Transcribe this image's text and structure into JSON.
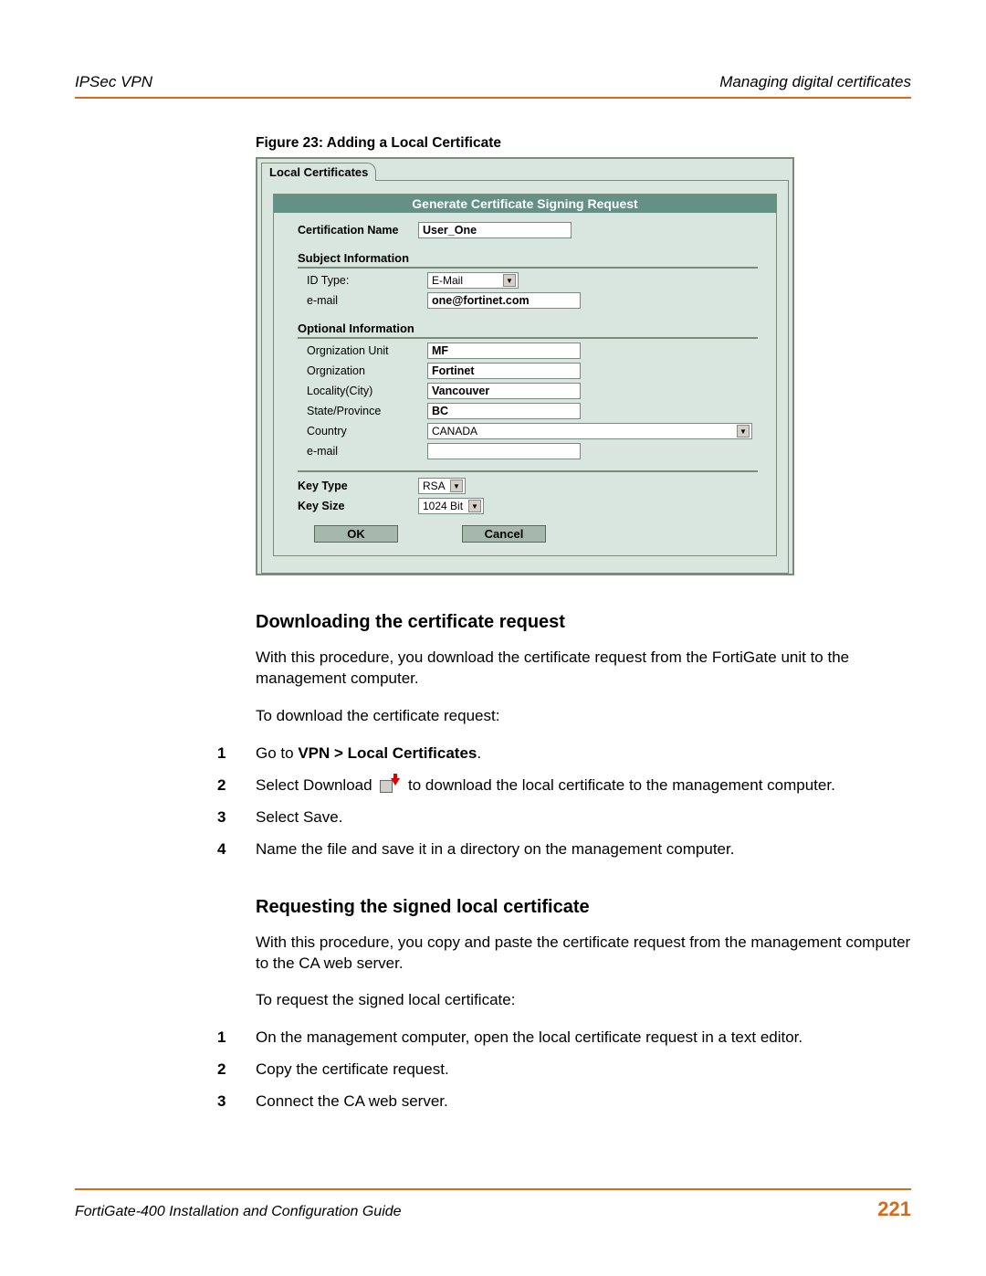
{
  "header": {
    "left": "IPSec VPN",
    "right": "Managing digital certificates"
  },
  "figure_caption": "Figure 23: Adding a Local Certificate",
  "screenshot": {
    "tab": "Local Certificates",
    "panel_title": "Generate Certificate Signing Request",
    "cert_name_label": "Certification Name",
    "cert_name_value": "User_One",
    "subject_heading": "Subject Information",
    "id_type_label": "ID Type:",
    "id_type_value": "E-Mail",
    "email_label": "e-mail",
    "email_value": "one@fortinet.com",
    "optional_heading": "Optional Information",
    "org_unit_label": "Orgnization Unit",
    "org_unit_value": "MF",
    "org_label": "Orgnization",
    "org_value": "Fortinet",
    "locality_label": "Locality(City)",
    "locality_value": "Vancouver",
    "state_label": "State/Province",
    "state_value": "BC",
    "country_label": "Country",
    "country_value": "CANADA",
    "opt_email_label": "e-mail",
    "opt_email_value": "",
    "key_type_label": "Key Type",
    "key_type_value": "RSA",
    "key_size_label": "Key Size",
    "key_size_value": "1024 Bit",
    "ok": "OK",
    "cancel": "Cancel"
  },
  "section1": {
    "heading": "Downloading the certificate request",
    "para1": "With this procedure, you download the certificate request from the FortiGate unit to the management computer.",
    "para2": "To download the certificate request:",
    "step1_pre": "Go to ",
    "step1_bold": "VPN > Local Certificates",
    "step1_post": ".",
    "step2_pre": "Select Download ",
    "step2_post": " to download the local certificate to the management computer.",
    "step3": "Select Save.",
    "step4": "Name the file and save it in a directory on the management computer."
  },
  "section2": {
    "heading": "Requesting the signed local certificate",
    "para1": "With this procedure, you copy and paste the certificate request from the management computer to the CA web server.",
    "para2": "To request the signed local certificate:",
    "step1": "On the management computer, open the local certificate request in a text editor.",
    "step2": "Copy the certificate request.",
    "step3": "Connect the CA web server."
  },
  "footer": {
    "text": "FortiGate-400 Installation and Configuration Guide",
    "page": "221"
  },
  "nums": {
    "n1": "1",
    "n2": "2",
    "n3": "3",
    "n4": "4"
  }
}
